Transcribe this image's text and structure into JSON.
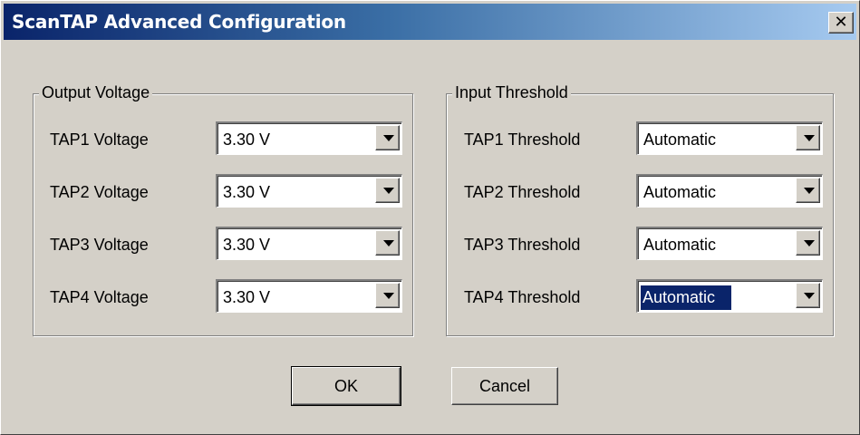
{
  "window": {
    "title": "ScanTAP Advanced Configuration",
    "close_glyph": "✕"
  },
  "output_voltage": {
    "legend": "Output Voltage",
    "rows": [
      {
        "label": "TAP1 Voltage",
        "value": "3.30 V"
      },
      {
        "label": "TAP2 Voltage",
        "value": "3.30 V"
      },
      {
        "label": "TAP3 Voltage",
        "value": "3.30 V"
      },
      {
        "label": "TAP4 Voltage",
        "value": "3.30 V"
      }
    ]
  },
  "input_threshold": {
    "legend": "Input Threshold",
    "rows": [
      {
        "label": "TAP1 Threshold",
        "value": "Automatic"
      },
      {
        "label": "TAP2 Threshold",
        "value": "Automatic"
      },
      {
        "label": "TAP3 Threshold",
        "value": "Automatic"
      },
      {
        "label": "TAP4 Threshold",
        "value": "Automatic"
      }
    ]
  },
  "buttons": {
    "ok": "OK",
    "cancel": "Cancel"
  },
  "colors": {
    "face": "#d4d0c8",
    "title_start": "#0a246a",
    "title_end": "#a6caf0",
    "selection": "#0a246a"
  }
}
